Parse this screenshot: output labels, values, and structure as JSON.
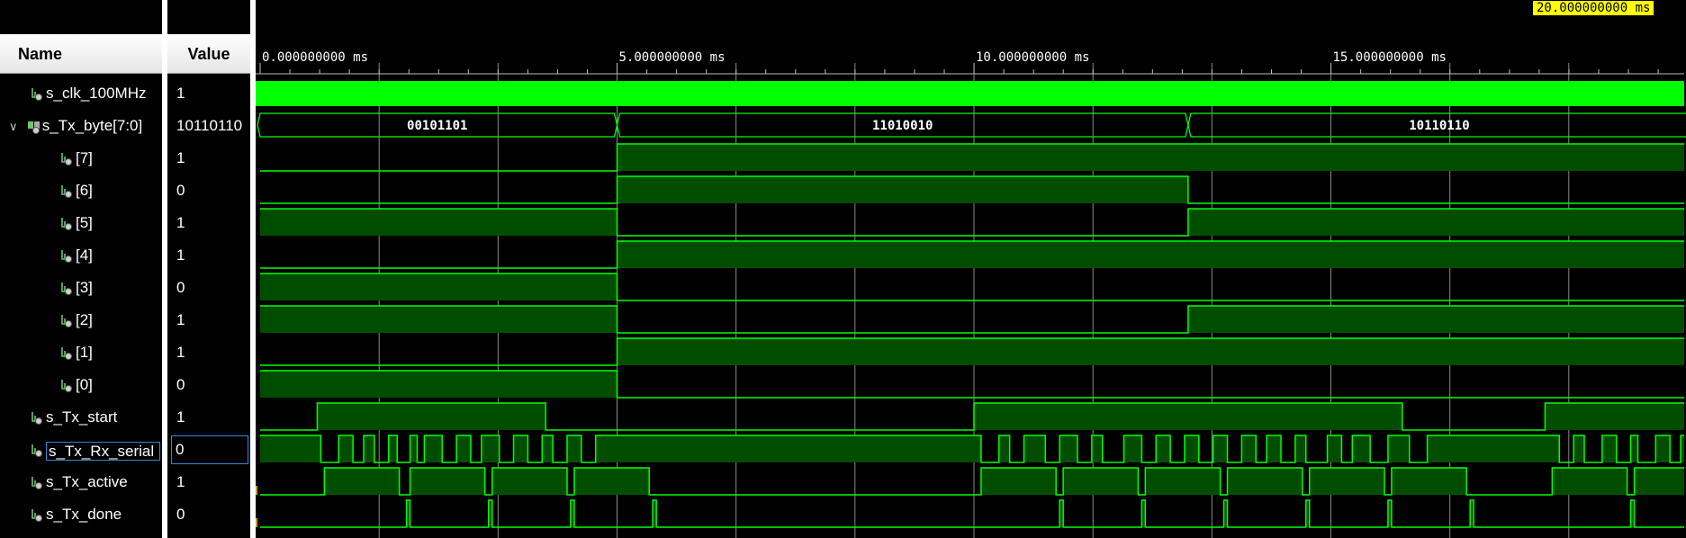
{
  "columns": {
    "name": "Name",
    "value": "Value"
  },
  "cursor_label": "20.000000000 ms",
  "time_ticks": [
    "0.000000000 ms",
    "5.000000000 ms",
    "10.000000000 ms",
    "15.000000000 ms"
  ],
  "colors": {
    "wave": "#00ff00",
    "wave_fill": "#004d00",
    "grid": "#8a8a8a",
    "selection": "#2d8ad8",
    "cursor_label_bg": "#ffff00"
  },
  "signals": [
    {
      "name": "s_clk_100MHz",
      "value": "1",
      "icon": "signal-icon"
    },
    {
      "name": "s_Tx_byte[7:0]",
      "value": "10110110",
      "icon": "bus-icon",
      "expanded": true
    },
    {
      "name": "[7]",
      "value": "1",
      "icon": "signal-icon"
    },
    {
      "name": "[6]",
      "value": "0",
      "icon": "signal-icon"
    },
    {
      "name": "[5]",
      "value": "1",
      "icon": "signal-icon"
    },
    {
      "name": "[4]",
      "value": "1",
      "icon": "signal-icon"
    },
    {
      "name": "[3]",
      "value": "0",
      "icon": "signal-icon"
    },
    {
      "name": "[2]",
      "value": "1",
      "icon": "signal-icon"
    },
    {
      "name": "[1]",
      "value": "1",
      "icon": "signal-icon"
    },
    {
      "name": "[0]",
      "value": "0",
      "icon": "signal-icon"
    },
    {
      "name": "s_Tx_start",
      "value": "1",
      "icon": "signal-icon"
    },
    {
      "name": "s_Tx_Rx_serial",
      "value": "0",
      "icon": "signal-icon",
      "selected": true
    },
    {
      "name": "s_Tx_active",
      "value": "1",
      "icon": "signal-icon"
    },
    {
      "name": "s_Tx_done",
      "value": "0",
      "icon": "signal-icon"
    }
  ],
  "bus_segments": [
    "00101101",
    "11010010",
    "10110110"
  ]
}
